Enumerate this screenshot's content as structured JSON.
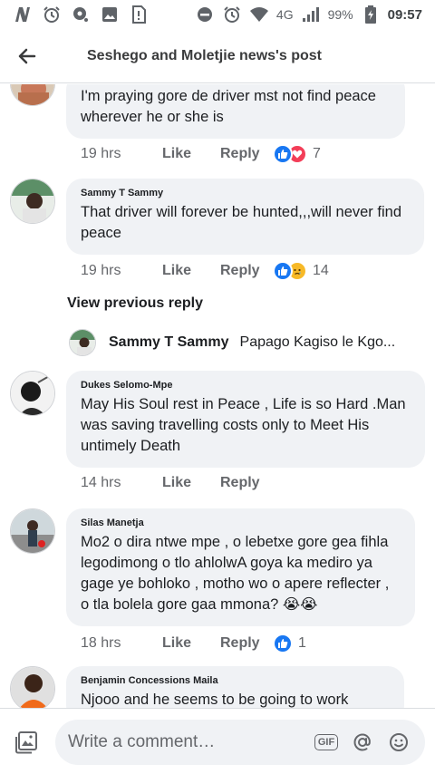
{
  "status_bar": {
    "network": "4G",
    "battery": "99%",
    "time": "09:57",
    "left_icons": [
      "n-app-icon",
      "alarm-icon",
      "location-icon",
      "gallery-icon",
      "sim-card-icon"
    ],
    "right_icons": [
      "do-not-disturb-icon",
      "alarm-icon",
      "wifi-icon",
      "signal-icon",
      "battery-charging-icon"
    ]
  },
  "header": {
    "title": "Seshego and Moletjie news's post"
  },
  "actions": {
    "like": "Like",
    "reply": "Reply"
  },
  "comments": [
    {
      "author": "",
      "text": "I'm praying gore de driver mst not find peace wherever he or she is",
      "time": "19 hrs",
      "reactions": [
        "like",
        "love"
      ],
      "reaction_count": "7"
    },
    {
      "author": "Sammy T Sammy",
      "text": "That driver will forever be hunted,,,will never find peace",
      "time": "19 hrs",
      "reactions": [
        "like",
        "sad"
      ],
      "reaction_count": "14"
    },
    {
      "author": "Dukes Selomo-Mpe",
      "text": "May His Soul rest in Peace , Life is so Hard .Man was saving travelling costs only to Meet His untimely Death",
      "time": "14 hrs",
      "reactions": [],
      "reaction_count": ""
    },
    {
      "author": "Silas Manetja",
      "text": "Mo2 o dira ntwe mpe , o lebetxe gore gea fihla legodimong o tlo ahlolwA goya ka mediro ya gage ye bohloko , motho wo o apere reflecter , o tla bolela gore gaa mmona? 😭😭",
      "time": "18 hrs",
      "reactions": [
        "like"
      ],
      "reaction_count": "1"
    },
    {
      "author": "Benjamin Concessions Maila",
      "text": "Njooo and he seems to be going to work",
      "time": "",
      "reactions": [],
      "reaction_count": ""
    }
  ],
  "view_previous_reply": "View previous reply",
  "reply_preview": {
    "author": "Sammy T Sammy",
    "snippet": "Papago Kagiso le Kgo..."
  },
  "composer": {
    "placeholder": "Write a comment…",
    "gif_label": "GIF"
  },
  "colors": {
    "like_blue": "#1877f2",
    "love_red": "#f33e58",
    "sad_yellow": "#f7b928",
    "bubble_bg": "#f0f2f5",
    "meta_gray": "#65676b"
  }
}
